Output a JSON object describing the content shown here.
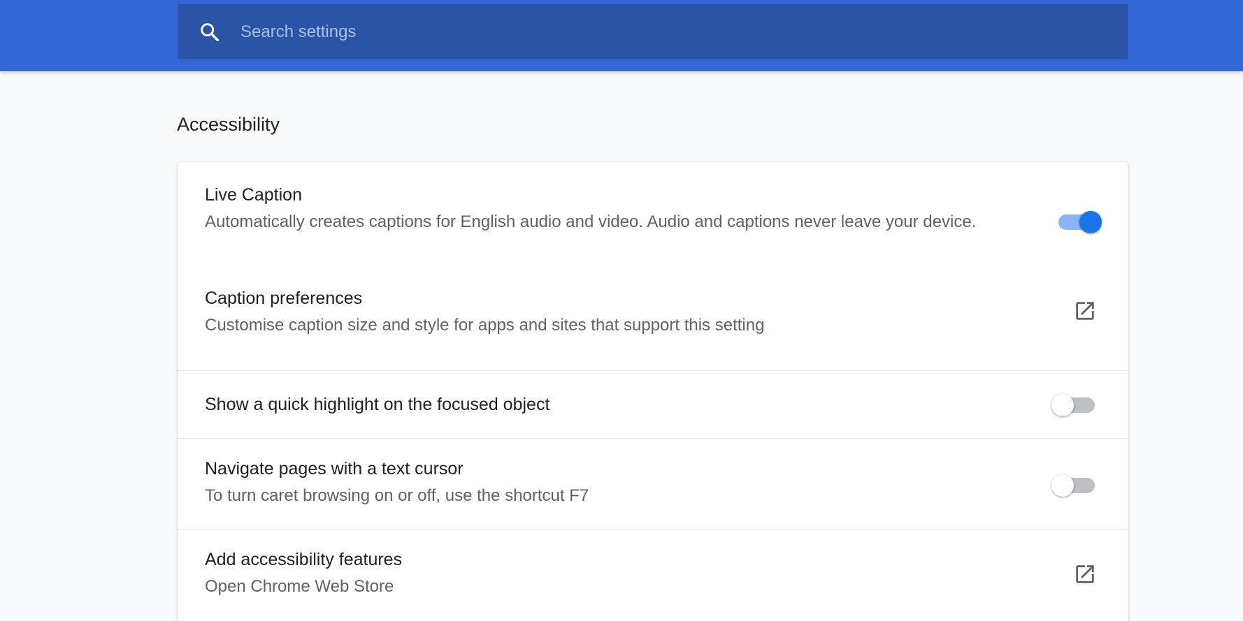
{
  "search": {
    "placeholder": "Search settings",
    "icon": "search-icon"
  },
  "section": {
    "title": "Accessibility"
  },
  "settings": [
    {
      "title": "Live Caption",
      "subtitle": "Automatically creates captions for English audio and video. Audio and captions never leave your device.",
      "control": "toggle",
      "enabled": true
    },
    {
      "title": "Caption preferences",
      "subtitle": "Customise caption size and style for apps and sites that support this setting",
      "control": "external-link",
      "icon": "open-in-new-icon"
    },
    {
      "title": "Show a quick highlight on the focused object",
      "control": "toggle",
      "enabled": false
    },
    {
      "title": "Navigate pages with a text cursor",
      "subtitle": "To turn caret browsing on or off, use the shortcut F7",
      "control": "toggle",
      "enabled": false
    },
    {
      "title": "Add accessibility features",
      "subtitle": "Open Chrome Web Store",
      "control": "external-link",
      "icon": "open-in-new-icon"
    }
  ],
  "colors": {
    "header_blue": "#3367d6",
    "search_box": "#2a54a6",
    "toggle_on": "#1a73e8",
    "toggle_on_track": "#8ab4f8",
    "toggle_off_track": "#bdc1c6"
  }
}
